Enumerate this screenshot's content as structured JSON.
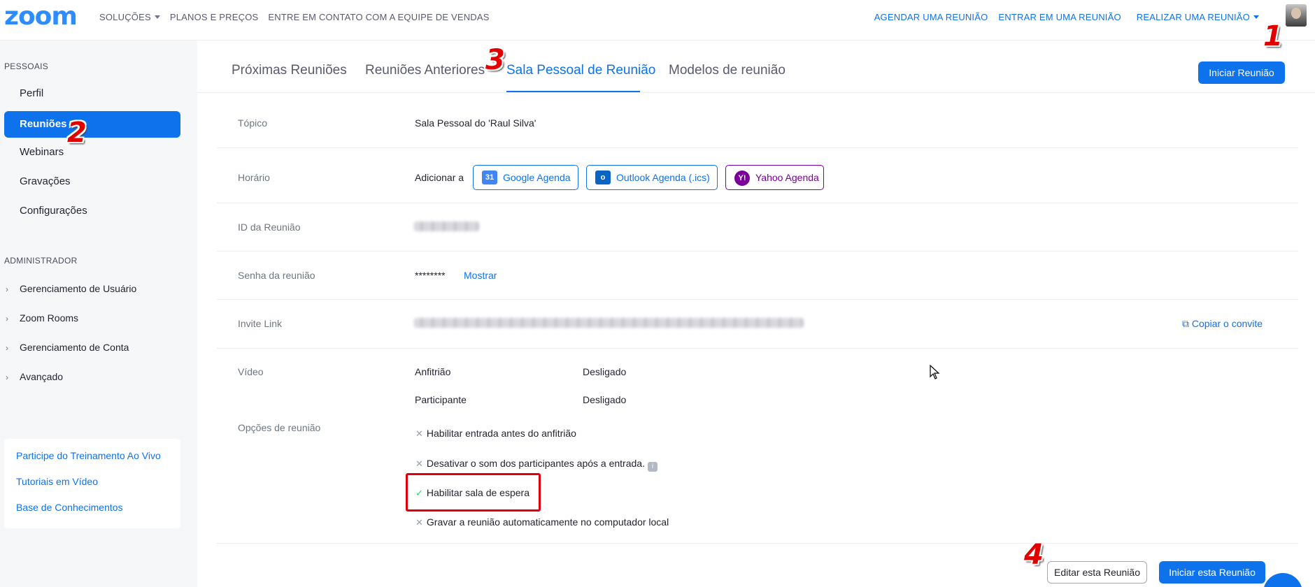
{
  "topnav": {
    "logo": "zoom",
    "left_items": [
      "SOLUÇÕES",
      "PLANOS E PREÇOS",
      "ENTRE EM CONTATO COM A EQUIPE DE VENDAS"
    ],
    "right_items": [
      "AGENDAR UMA REUNIÃO",
      "ENTRAR EM UMA REUNIÃO",
      "REALIZAR UMA REUNIÃO"
    ]
  },
  "badges": [
    "1",
    "2",
    "3",
    "4"
  ],
  "sidebar": {
    "personal_heading": "PESSOAIS",
    "personal_items": [
      "Perfil",
      "Reuniões",
      "Webinars",
      "Gravações",
      "Configurações"
    ],
    "admin_heading": "ADMINISTRADOR",
    "admin_items": [
      "Gerenciamento de Usuário",
      "Zoom Rooms",
      "Gerenciamento de Conta",
      "Avançado"
    ],
    "help_links": [
      "Participe do Treinamento Ao Vivo",
      "Tutoriais em Vídeo",
      "Base de Conhecimentos"
    ]
  },
  "tabs": [
    "Próximas Reuniões",
    "Reuniões Anteriores",
    "Sala Pessoal de Reunião",
    "Modelos de reunião"
  ],
  "start_meeting_button": "Iniciar Reunião",
  "details": {
    "topic_label": "Tópico",
    "topic_value": "Sala Pessoal do 'Raul Silva'",
    "time_label": "Horário",
    "add_to": "Adicionar a",
    "calendars": [
      "Google Agenda",
      "Outlook Agenda (.ics)",
      "Yahoo Agenda"
    ],
    "calendar_icon_text": [
      "31",
      "o",
      "Y!"
    ],
    "meeting_id_label": "ID da Reunião",
    "password_label": "Senha da reunião",
    "password_value": "********",
    "show_link": "Mostrar",
    "invite_label": "Invite Link",
    "copy_invite": "Copiar o convite",
    "video_label": "Vídeo",
    "host_label": "Anfitrião",
    "host_value": "Desligado",
    "participant_label": "Participante",
    "participant_value": "Desligado",
    "options_label": "Opções de reunião",
    "options": [
      {
        "text": "Habilitar entrada antes do anfitrião",
        "enabled": false
      },
      {
        "text": "Desativar o som dos participantes após a entrada.",
        "enabled": false
      },
      {
        "text": "Habilitar sala de espera",
        "enabled": true
      },
      {
        "text": "Gravar a reunião automaticamente no computador local",
        "enabled": false
      }
    ]
  },
  "footer_buttons": {
    "edit": "Editar esta Reunião",
    "start": "Iniciar esta Reunião"
  },
  "colors": {
    "accent": "#0e72ed",
    "logo": "#2d8cff",
    "annotation": "#e00000",
    "yahoo": "#7b0099"
  }
}
